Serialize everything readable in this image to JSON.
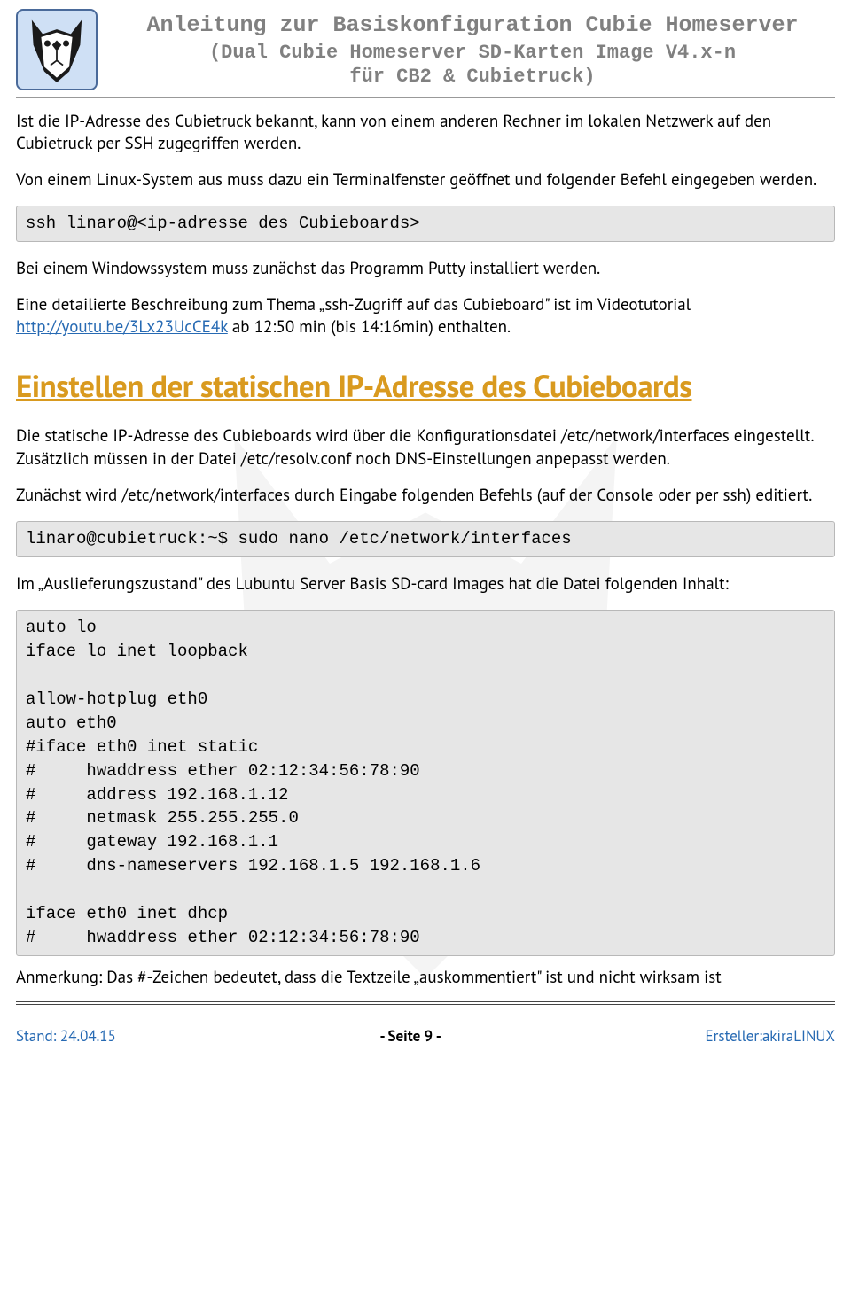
{
  "header": {
    "title_line1": "Anleitung zur Basiskonfiguration Cubie Homeserver",
    "title_line2": "(Dual Cubie Homeserver SD-Karten Image V4.x-n",
    "title_line3": "für CB2 & Cubietruck)"
  },
  "para1": "Ist die IP-Adresse des Cubietruck bekannt, kann von einem anderen Rechner im lokalen Netzwerk auf den Cubietruck per SSH zugegriffen werden.",
  "para2": "Von einem Linux-System aus muss dazu ein Terminalfenster geöffnet und folgender Befehl eingegeben werden.",
  "code1": "ssh linaro@<ip-adresse des Cubieboards>",
  "para3": "Bei einem Windowssystem muss zunächst das Programm Putty installiert werden.",
  "para4_pre": "Eine detailierte Beschreibung zum Thema „ssh-Zugriff auf das Cubieboard\" ist im Videotutorial ",
  "para4_link": "http://youtu.be/3Lx23UcCE4k",
  "para4_post": "  ab 12:50 min (bis 14:16min) enthalten.",
  "heading": "Einstellen der statischen IP-Adresse des Cubieboards",
  "para5": "Die statische IP-Adresse des Cubieboards wird über die Konfigurationsdatei /etc/network/interfaces eingestellt. Zusätzlich müssen in der Datei /etc/resolv.conf noch DNS-Einstellungen anpepasst werden.",
  "para6": "Zunächst wird /etc/network/interfaces durch Eingabe folgenden Befehls (auf der Console oder per ssh) editiert.",
  "code2": "linaro@cubietruck:~$ sudo nano /etc/network/interfaces",
  "para7": "Im „Auslieferungszustand\" des Lubuntu Server Basis SD-card Images hat die Datei folgenden Inhalt:",
  "code3": "auto lo\niface lo inet loopback\n\nallow-hotplug eth0\nauto eth0\n#iface eth0 inet static\n#     hwaddress ether 02:12:34:56:78:90\n#     address 192.168.1.12\n#     netmask 255.255.255.0\n#     gateway 192.168.1.1\n#     dns-nameservers 192.168.1.5 192.168.1.6\n\niface eth0 inet dhcp\n#     hwaddress ether 02:12:34:56:78:90",
  "para8": "Anmerkung: Das #-Zeichen bedeutet, dass die Textzeile „auskommentiert\" ist und nicht wirksam ist",
  "footer": {
    "left": "Stand: 24.04.15",
    "center": "- Seite 9 -",
    "right": "Ersteller:akiraLINUX"
  }
}
